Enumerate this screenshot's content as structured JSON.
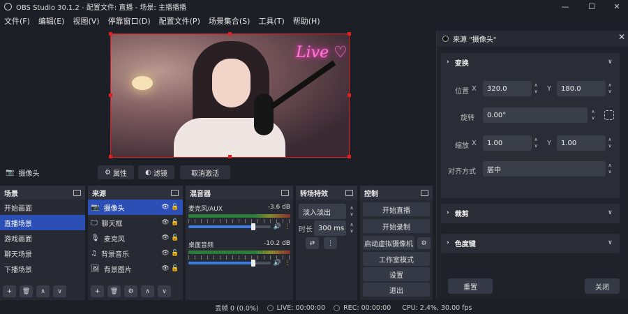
{
  "window": {
    "title": "OBS Studio 30.1.2 - 配置文件: 直播 - 场景: 主播播播"
  },
  "menu": [
    "文件(F)",
    "编辑(E)",
    "视图(V)",
    "停靠窗口(D)",
    "配置文件(P)",
    "场景集合(S)",
    "工具(T)",
    "帮助(H)"
  ],
  "preview": {
    "neon_text": "Live ♡"
  },
  "source_bar": {
    "current_source": "摄像头",
    "properties_label": "属性",
    "filters_label": "滤镜",
    "deactivate_label": "取消激活"
  },
  "scenes": {
    "title": "场景",
    "items": [
      "开始画面",
      "直播场景",
      "游戏画面",
      "聊天场景",
      "下播场景"
    ],
    "selected_index": 1
  },
  "sources": {
    "title": "来源",
    "items": [
      {
        "name": "摄像头",
        "icon": "camera-icon"
      },
      {
        "name": "聊天框",
        "icon": "monitor-icon"
      },
      {
        "name": "麦克风",
        "icon": "mic-icon"
      },
      {
        "name": "背景音乐",
        "icon": "music-icon"
      },
      {
        "name": "背景图片",
        "icon": "image-icon"
      }
    ],
    "selected_index": 0
  },
  "mixer": {
    "title": "混音器",
    "channels": [
      {
        "name": "麦克风/AUX",
        "db": "-3.6 dB",
        "level": 0.78
      },
      {
        "name": "桌面音频",
        "db": "-10.2 dB",
        "level": 0.78
      }
    ]
  },
  "transitions": {
    "title": "转场特效",
    "type": "淡入淡出",
    "duration_label": "时长",
    "duration": "300 ms"
  },
  "controls": {
    "title": "控制",
    "start_stream": "开始直播",
    "start_record": "开始录制",
    "virtual_cam": "启动虚拟摄像机",
    "studio_mode": "工作室模式",
    "settings": "设置",
    "exit": "退出"
  },
  "status": {
    "dropped": "丢帧 0 (0.0%)",
    "live": "LIVE: 00:00:00",
    "rec": "REC: 00:00:00",
    "cpu": "CPU: 2.4%, 30.00 fps"
  },
  "props_panel": {
    "title": "来源 \"摄像头\"",
    "transform": {
      "title": "变换",
      "position_label": "位置",
      "x_label": "X",
      "y_label": "Y",
      "pos_x": "320.0",
      "pos_y": "180.0",
      "rotation_label": "旋转",
      "rotation": "0.00°",
      "scale_label": "缩放",
      "scale_x": "1.00",
      "scale_y": "1.00",
      "align_label": "对齐方式",
      "align": "居中"
    },
    "crop_title": "裁剪",
    "chroma_title": "色度键",
    "reset_label": "重置",
    "close_label": "关闭"
  },
  "colors": {
    "accent": "#2b4fb5",
    "selection_border": "#e02020",
    "neon": "#ff7ad9"
  }
}
